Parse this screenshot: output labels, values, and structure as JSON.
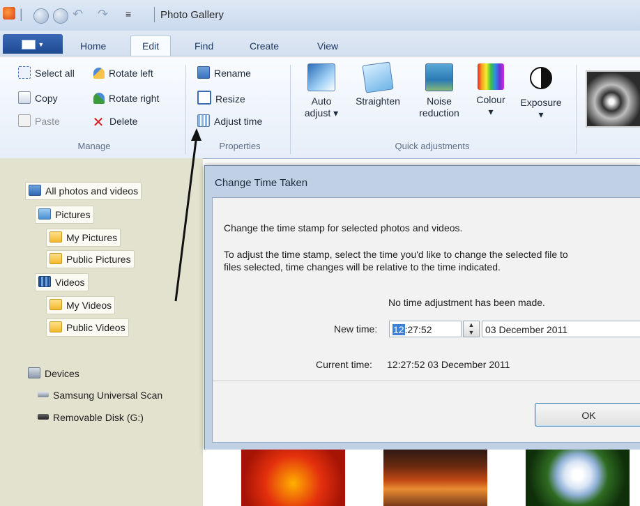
{
  "titlebar": {
    "title": "Photo Gallery",
    "quick_access_icons": [
      "app-icon",
      "back-icon",
      "forward-icon",
      "undo-icon",
      "redo-icon",
      "customize-icon"
    ]
  },
  "ribbon_tabs": [
    "Home",
    "Edit",
    "Find",
    "Create",
    "View"
  ],
  "active_tab": "Edit",
  "ribbon": {
    "manage": {
      "label": "Manage",
      "select_all": "Select all",
      "copy": "Copy",
      "paste": "Paste",
      "rotate_left": "Rotate left",
      "rotate_right": "Rotate right",
      "delete": "Delete"
    },
    "properties": {
      "label": "Properties",
      "rename": "Rename",
      "resize": "Resize",
      "adjust_time": "Adjust time"
    },
    "quick_adjustments": {
      "label": "Quick adjustments",
      "auto_adjust": [
        "Auto",
        "adjust ▾"
      ],
      "straighten": "Straighten",
      "noise_reduction": [
        "Noise",
        "reduction"
      ],
      "colour": [
        "Colour",
        "▾"
      ],
      "exposure": [
        "Exposure",
        "▾"
      ]
    }
  },
  "nav": {
    "all_photos": "All photos and videos",
    "pictures": "Pictures",
    "my_pictures": "My Pictures",
    "public_pictures": "Public Pictures",
    "videos": "Videos",
    "my_videos": "My Videos",
    "public_videos": "Public Videos",
    "devices": "Devices",
    "scanner": "Samsung Universal Scan",
    "removable_disk": "Removable Disk (G:)"
  },
  "dialog": {
    "title": "Change Time Taken",
    "line1": "Change the time stamp for selected photos and videos.",
    "line2": "To adjust the time stamp, select the time you'd like to change the selected file to",
    "line3": "files selected, time changes will be relative to the time indicated.",
    "status": "No time adjustment has been made.",
    "new_time_label": "New time:",
    "new_time_hour": "12",
    "new_time_rest": ":27:52",
    "new_date": "03 December  2011",
    "current_time_label": "Current time:",
    "current_time_value": "12:27:52 03 December 2011",
    "ok": "OK"
  },
  "colors": {
    "nav_background": "#e2e2cf",
    "dialog_frame": "#c0d1e6",
    "ribbon_background": "#eef3fa",
    "selection": "#3f7fd6"
  }
}
